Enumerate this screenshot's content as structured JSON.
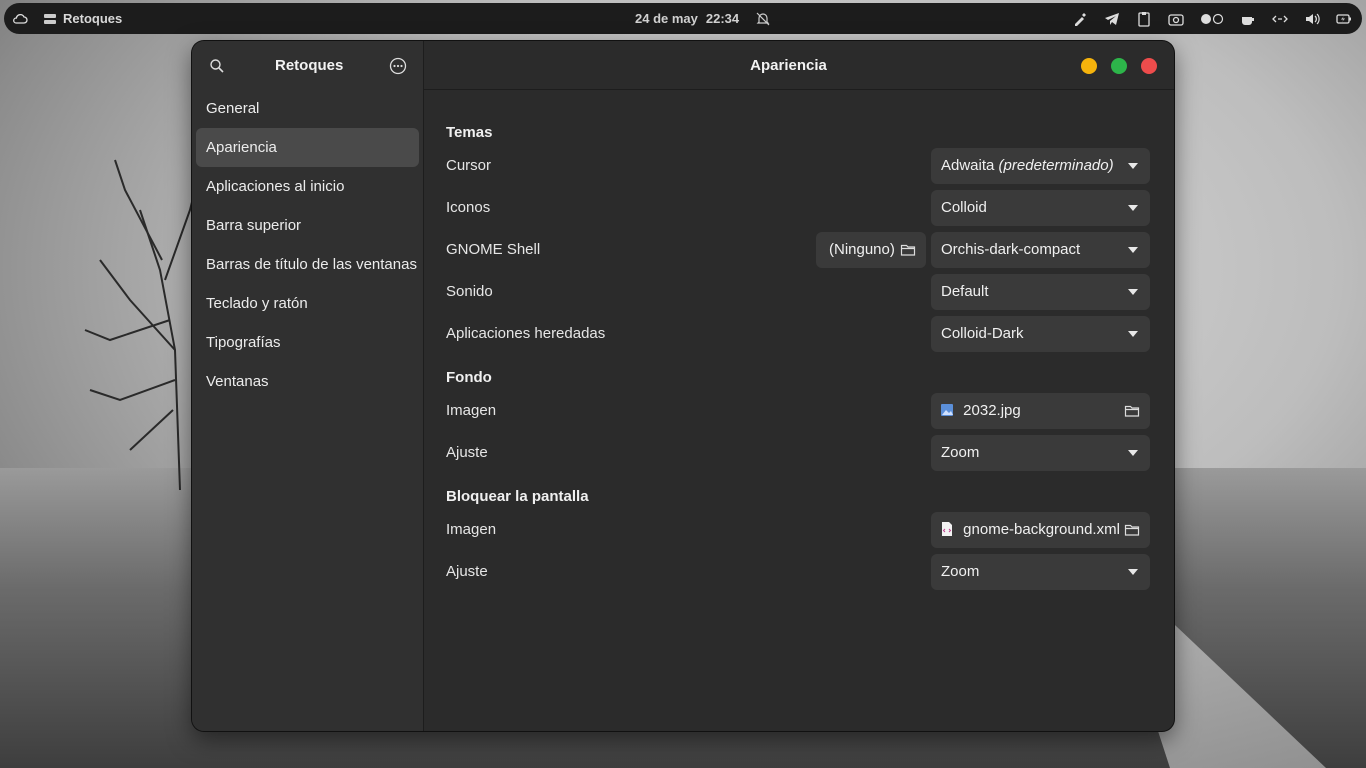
{
  "topbar": {
    "app_name": "Retoques",
    "date": "24 de may",
    "time": "22:34"
  },
  "window": {
    "sidebar_title": "Retoques",
    "page_title": "Apariencia",
    "nav": [
      {
        "label": "General"
      },
      {
        "label": "Apariencia"
      },
      {
        "label": "Aplicaciones al inicio"
      },
      {
        "label": "Barra superior"
      },
      {
        "label": "Barras de título de las ventanas"
      },
      {
        "label": "Teclado y ratón"
      },
      {
        "label": "Tipografías"
      },
      {
        "label": "Ventanas"
      }
    ],
    "active_nav": "Apariencia"
  },
  "themes": {
    "section": "Temas",
    "cursor_label": "Cursor",
    "cursor_value": "Adwaita",
    "cursor_value_suffix": "(predeterminado)",
    "icons_label": "Iconos",
    "icons_value": "Colloid",
    "shell_label": "GNOME Shell",
    "shell_none_button": "(Ninguno)",
    "shell_value": "Orchis-dark-compact",
    "sound_label": "Sonido",
    "sound_value": "Default",
    "legacy_label": "Aplicaciones heredadas",
    "legacy_value": "Colloid-Dark"
  },
  "background": {
    "section": "Fondo",
    "image_label": "Imagen",
    "image_value": "2032.jpg",
    "adjust_label": "Ajuste",
    "adjust_value": "Zoom"
  },
  "lockscreen": {
    "section": "Bloquear la pantalla",
    "image_label": "Imagen",
    "image_value": "gnome-background.xml",
    "adjust_label": "Ajuste",
    "adjust_value": "Zoom"
  },
  "colors": {
    "minimize": "#f5b30c",
    "maximize": "#2db54a",
    "close": "#ee4c4c"
  }
}
